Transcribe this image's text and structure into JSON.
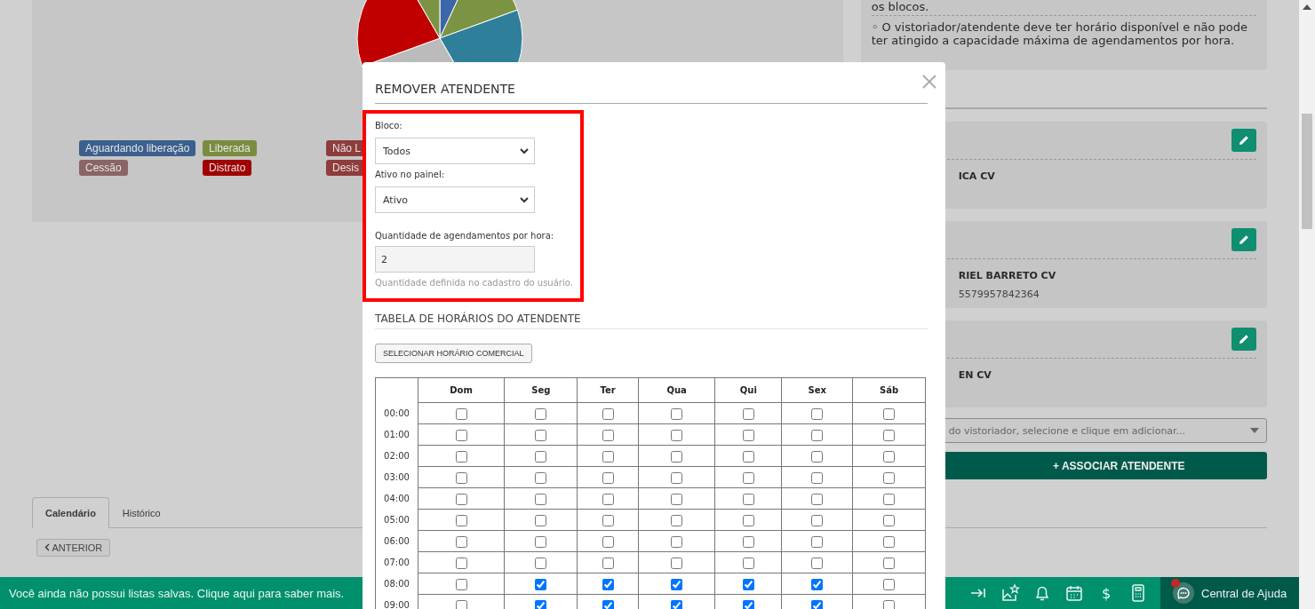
{
  "chart": {
    "legend": [
      {
        "label": "Aguardando liberação",
        "color": "#3c5f8e"
      },
      {
        "label": "Liberada",
        "color": "#7a8c3e"
      },
      {
        "label": "Não L",
        "color": "#8f3c3c"
      },
      {
        "label": "Cessão",
        "color": "#8a6565"
      },
      {
        "label": "Distrato",
        "color": "#a00000"
      },
      {
        "label": "Desis",
        "color": "#8f3c3c"
      }
    ]
  },
  "info_panel": {
    "fragment": "os blocos.",
    "note": "◦ O vistoriador/atendente deve ter horário disponível e não pode ter atingido a capacidade máxima de agendamentos por hora."
  },
  "attendants": [
    {
      "name": "ICA CV"
    },
    {
      "name": "RIEL BARRETO CV",
      "phone": "5579957842364"
    },
    {
      "name": "EN CV"
    }
  ],
  "attendant_select": {
    "placeholder": "do vistoriador, selecione e clique em adicionar..."
  },
  "associate_button": "+ ASSOCIAR ATENDENTE",
  "tabs": [
    {
      "label": "Calendário",
      "selected": true
    },
    {
      "label": "Histórico",
      "selected": false
    }
  ],
  "previous_button": "ANTERIOR",
  "bottom_bar": {
    "message": "Você ainda não possui listas salvas. Clique aqui para saber mais.",
    "currency_symbol": "$",
    "help_label": "Central de Ajuda",
    "help_notification": true
  },
  "modal": {
    "title": "REMOVER ATENDENTE",
    "fields": [
      {
        "kind": "select",
        "label": "Bloco:",
        "value": "Todos"
      },
      {
        "kind": "select",
        "label": "Ativo no painel:",
        "value": "Ativo"
      },
      {
        "kind": "readonly",
        "label": "Quantidade de agendamentos por hora:",
        "value": "2",
        "hint": "Quantidade definida no cadastro do usuário."
      }
    ],
    "schedule_title": "TABELA DE HORÁRIOS DO ATENDENTE",
    "business_hours_button": "SELECIONAR HORÁRIO COMERCIAL",
    "days": [
      "Dom",
      "Seg",
      "Ter",
      "Qua",
      "Qui",
      "Sex",
      "Sáb"
    ],
    "rows": [
      {
        "time": "00:00",
        "checked": [
          false,
          false,
          false,
          false,
          false,
          false,
          false
        ]
      },
      {
        "time": "01:00",
        "checked": [
          false,
          false,
          false,
          false,
          false,
          false,
          false
        ]
      },
      {
        "time": "02:00",
        "checked": [
          false,
          false,
          false,
          false,
          false,
          false,
          false
        ]
      },
      {
        "time": "03:00",
        "checked": [
          false,
          false,
          false,
          false,
          false,
          false,
          false
        ]
      },
      {
        "time": "04:00",
        "checked": [
          false,
          false,
          false,
          false,
          false,
          false,
          false
        ]
      },
      {
        "time": "05:00",
        "checked": [
          false,
          false,
          false,
          false,
          false,
          false,
          false
        ]
      },
      {
        "time": "06:00",
        "checked": [
          false,
          false,
          false,
          false,
          false,
          false,
          false
        ]
      },
      {
        "time": "07:00",
        "checked": [
          false,
          false,
          false,
          false,
          false,
          false,
          false
        ]
      },
      {
        "time": "08:00",
        "checked": [
          false,
          true,
          true,
          true,
          true,
          true,
          false
        ]
      },
      {
        "time": "09:00",
        "checked": [
          false,
          true,
          true,
          true,
          true,
          true,
          false
        ]
      }
    ]
  }
}
